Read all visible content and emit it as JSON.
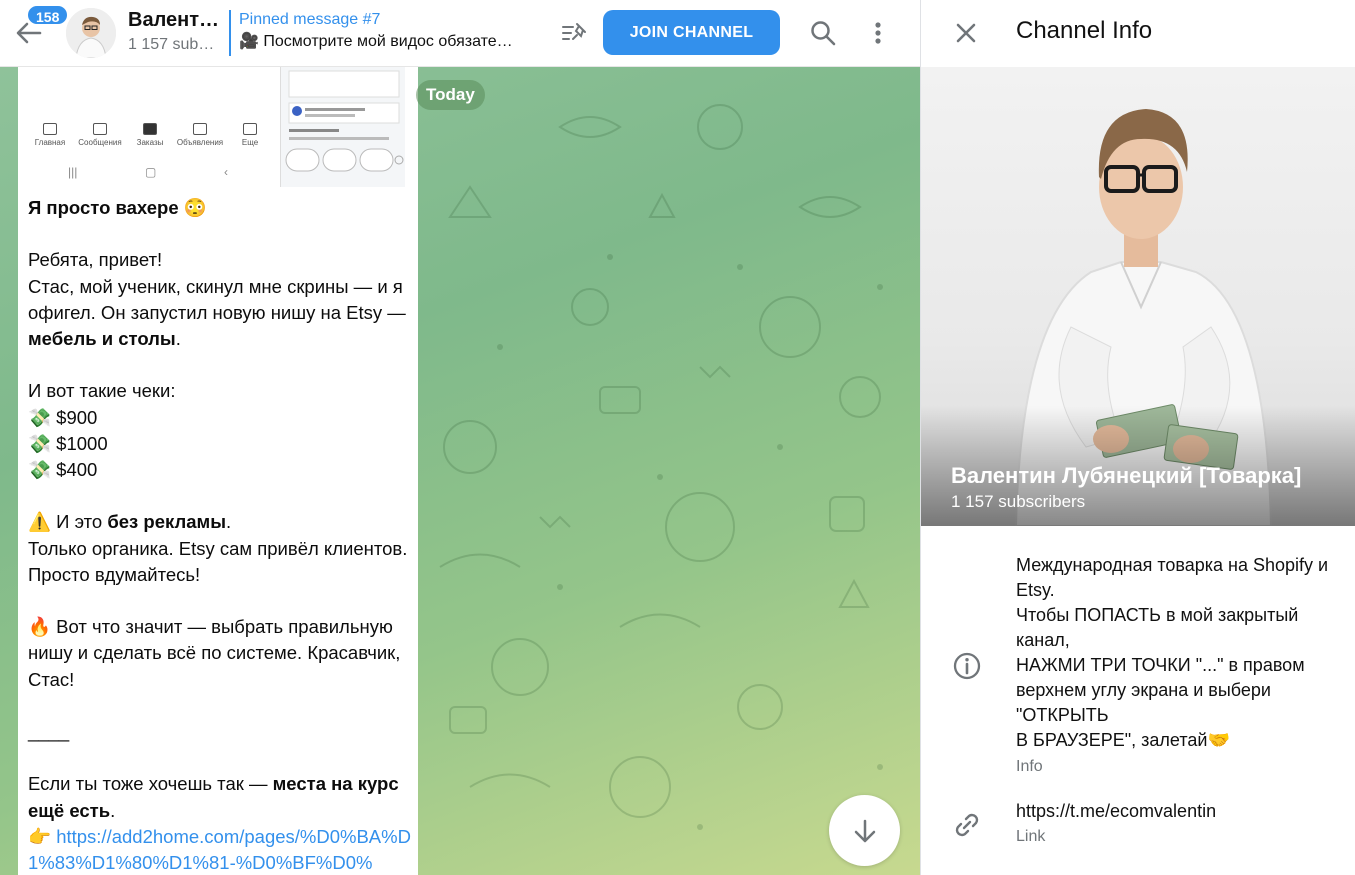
{
  "header": {
    "unread_count": "158",
    "channel_name": "Валент…",
    "channel_subs": "1 157 sub…",
    "pinned_title": "Pinned message #7",
    "pinned_text": "🎥 Посмотрите мой видос обязате…",
    "join_label": "JOIN CHANNEL"
  },
  "chat": {
    "date_label": "Today",
    "screenshot_nav": [
      "Главная",
      "Сообщения",
      "Заказы",
      "Объявления",
      "Еще"
    ]
  },
  "message": {
    "line_01": "Я просто вахере 😳",
    "line_02": "Ребята, привет!\nСтас, мой ученик, скинул мне скрины — и я офигел. Он запустил новую нишу на Etsy — ",
    "line_02_bold": "мебель и столы",
    "line_02_end": ".",
    "line_03": "И вот такие чеки:\n💸 $900\n💸 $1000\n💸 $400",
    "line_04": "⚠️ И это ",
    "line_04_bold": "без рекламы",
    "line_04_end": ".\nТолько органика. Etsy сам привёл клиентов. Просто вдумайтесь!",
    "line_05": "🔥 Вот что значит — выбрать правильную нишу и сделать всё по системе. Красавчик, Стас!",
    "line_06": "____",
    "line_07": "Если ты тоже хочешь так — ",
    "line_07_bold": "места на курс ещё есть",
    "line_07_end": ".",
    "link_prefix": "👉 ",
    "link": "https://add2home.com/pages/%D0%BA%D1%83%D1%80%D1%81-%D0%BF%D0%"
  },
  "info": {
    "title": "Channel Info",
    "name": "Валентин Лубянецкий [Товарка]",
    "subscribers": "1 157 subscribers",
    "description": "Международная товарка на Shopify и Etsy.\nЧтобы ПОПАСТЬ в мой закрытый канал,\nНАЖМИ ТРИ ТОЧКИ \"...\" в правом верхнем углу экрана и выбери \"ОТКРЫТЬ\nВ БРАУЗЕРЕ\", залетай🤝",
    "description_label": "Info",
    "link": "https://t.me/ecomvalentin",
    "link_label": "Link"
  },
  "colors": {
    "accent": "#3390ec",
    "secondary_text": "#707579"
  }
}
